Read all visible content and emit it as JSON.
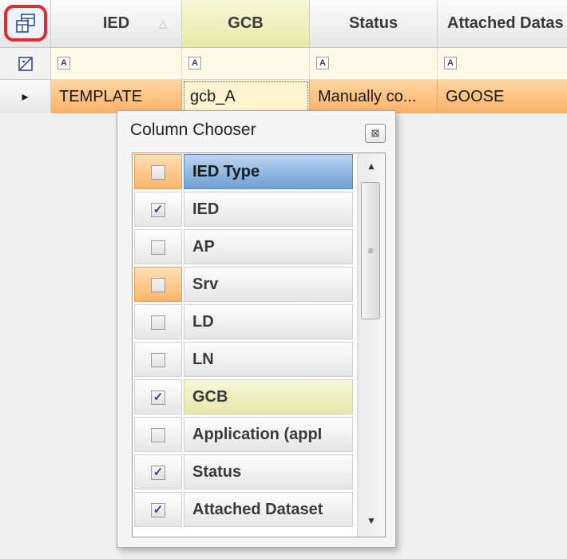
{
  "grid": {
    "columns": [
      {
        "label": "IED",
        "sort": "ascending"
      },
      {
        "label": "GCB"
      },
      {
        "label": "Status"
      },
      {
        "label": "Attached Datas"
      }
    ],
    "filter_icon": "A",
    "row": {
      "indicator": "▸",
      "cells": [
        "TEMPLATE",
        "gcb_A",
        "Manually co...",
        "GOOSE"
      ]
    }
  },
  "column_chooser": {
    "title": "Column Chooser",
    "close_glyph": "⊠",
    "items": [
      {
        "label": "IED Type",
        "checked": false
      },
      {
        "label": "IED",
        "checked": true
      },
      {
        "label": "AP",
        "checked": false
      },
      {
        "label": "Srv",
        "checked": false
      },
      {
        "label": "LD",
        "checked": false
      },
      {
        "label": "LN",
        "checked": false
      },
      {
        "label": "GCB",
        "checked": true
      },
      {
        "label": "Application (appI",
        "checked": false
      },
      {
        "label": "Status",
        "checked": true
      },
      {
        "label": "Attached Dataset",
        "checked": true
      }
    ],
    "check_glyph": "✓",
    "scroll_up": "▲",
    "scroll_down": "▼",
    "thumb_grip": "≡"
  },
  "colors": {
    "highlight_border": "#e8282e",
    "row_orange": "#fbb166",
    "selected_blue": "#6d9fd4"
  }
}
